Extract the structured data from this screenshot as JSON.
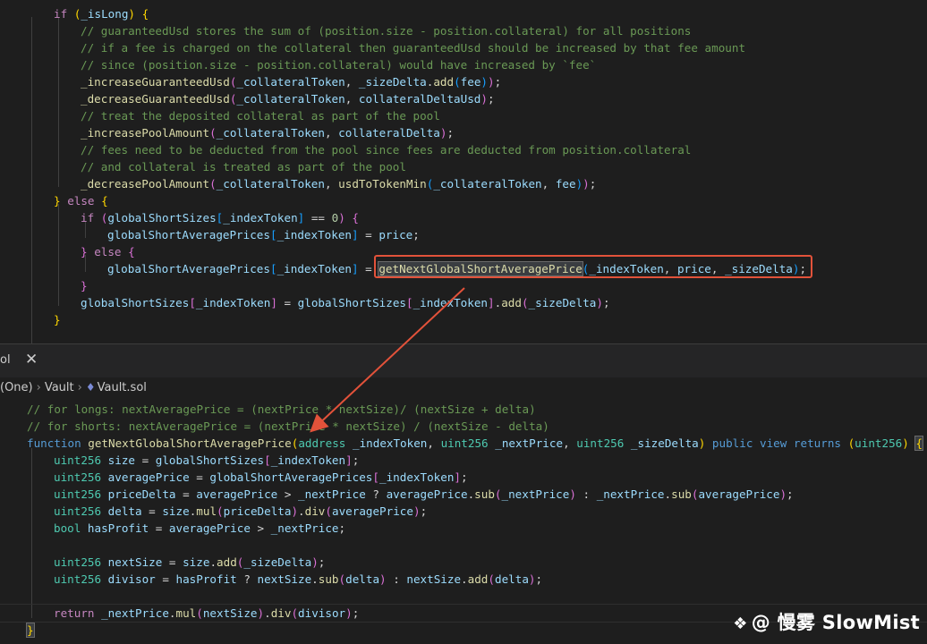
{
  "editor_top": {
    "lines": [
      [
        [
          "c-kw",
          "if "
        ],
        [
          "c-br1",
          "("
        ],
        [
          "c-var",
          "_isLong"
        ],
        [
          "c-br1",
          ")"
        ],
        [
          "c-plain",
          " "
        ],
        [
          "c-br1",
          "{"
        ]
      ],
      [
        [
          "c-com",
          "// guaranteedUsd stores the sum of (position.size - position.collateral) for all positions"
        ]
      ],
      [
        [
          "c-com",
          "// if a fee is charged on the collateral then guaranteedUsd should be increased by that fee amount"
        ]
      ],
      [
        [
          "c-com",
          "// since (position.size - position.collateral) would have increased by `fee`"
        ]
      ],
      [
        [
          "c-fn",
          "_increaseGuaranteedUsd"
        ],
        [
          "c-br2",
          "("
        ],
        [
          "c-var",
          "_collateralToken"
        ],
        [
          "c-plain",
          ", "
        ],
        [
          "c-var",
          "_sizeDelta"
        ],
        [
          "c-plain",
          "."
        ],
        [
          "c-fn",
          "add"
        ],
        [
          "c-br3",
          "("
        ],
        [
          "c-var",
          "fee"
        ],
        [
          "c-br3",
          ")"
        ],
        [
          "c-br2",
          ")"
        ],
        [
          "c-plain",
          ";"
        ]
      ],
      [
        [
          "c-fn",
          "_decreaseGuaranteedUsd"
        ],
        [
          "c-br2",
          "("
        ],
        [
          "c-var",
          "_collateralToken"
        ],
        [
          "c-plain",
          ", "
        ],
        [
          "c-var",
          "collateralDeltaUsd"
        ],
        [
          "c-br2",
          ")"
        ],
        [
          "c-plain",
          ";"
        ]
      ],
      [
        [
          "c-com",
          "// treat the deposited collateral as part of the pool"
        ]
      ],
      [
        [
          "c-fn",
          "_increasePoolAmount"
        ],
        [
          "c-br2",
          "("
        ],
        [
          "c-var",
          "_collateralToken"
        ],
        [
          "c-plain",
          ", "
        ],
        [
          "c-var",
          "collateralDelta"
        ],
        [
          "c-br2",
          ")"
        ],
        [
          "c-plain",
          ";"
        ]
      ],
      [
        [
          "c-com",
          "// fees need to be deducted from the pool since fees are deducted from position.collateral"
        ]
      ],
      [
        [
          "c-com",
          "// and collateral is treated as part of the pool"
        ]
      ],
      [
        [
          "c-fn",
          "_decreasePoolAmount"
        ],
        [
          "c-br2",
          "("
        ],
        [
          "c-var",
          "_collateralToken"
        ],
        [
          "c-plain",
          ", "
        ],
        [
          "c-fn",
          "usdToTokenMin"
        ],
        [
          "c-br3",
          "("
        ],
        [
          "c-var",
          "_collateralToken"
        ],
        [
          "c-plain",
          ", "
        ],
        [
          "c-var",
          "fee"
        ],
        [
          "c-br3",
          ")"
        ],
        [
          "c-br2",
          ")"
        ],
        [
          "c-plain",
          ";"
        ]
      ],
      [
        [
          "c-br1",
          "}"
        ],
        [
          "c-plain",
          " "
        ],
        [
          "c-kw",
          "else"
        ],
        [
          "c-plain",
          " "
        ],
        [
          "c-br1",
          "{"
        ]
      ],
      [
        [
          "c-kw",
          "if "
        ],
        [
          "c-br2",
          "("
        ],
        [
          "c-var",
          "globalShortSizes"
        ],
        [
          "c-br3",
          "["
        ],
        [
          "c-var",
          "_indexToken"
        ],
        [
          "c-br3",
          "]"
        ],
        [
          "c-plain",
          " == "
        ],
        [
          "c-num",
          "0"
        ],
        [
          "c-br2",
          ")"
        ],
        [
          "c-plain",
          " "
        ],
        [
          "c-br2",
          "{"
        ]
      ],
      [
        [
          "c-var",
          "globalShortAveragePrices"
        ],
        [
          "c-br3",
          "["
        ],
        [
          "c-var",
          "_indexToken"
        ],
        [
          "c-br3",
          "]"
        ],
        [
          "c-plain",
          " = "
        ],
        [
          "c-var",
          "price"
        ],
        [
          "c-plain",
          ";"
        ]
      ],
      [
        [
          "c-br2",
          "}"
        ],
        [
          "c-plain",
          " "
        ],
        [
          "c-kw",
          "else"
        ],
        [
          "c-plain",
          " "
        ],
        [
          "c-br2",
          "{"
        ]
      ],
      [
        [
          "c-var",
          "globalShortAveragePrices"
        ],
        [
          "c-br3",
          "["
        ],
        [
          "c-var",
          "_indexToken"
        ],
        [
          "c-br3",
          "]"
        ],
        [
          "c-plain",
          " = "
        ],
        [
          "c-fn hl-sel",
          "getNextGlobalShortAveragePrice"
        ],
        [
          "c-br3",
          "("
        ],
        [
          "c-var",
          "_indexToken"
        ],
        [
          "c-plain",
          ", "
        ],
        [
          "c-var",
          "price"
        ],
        [
          "c-plain",
          ", "
        ],
        [
          "c-var",
          "_sizeDelta"
        ],
        [
          "c-br3",
          ")"
        ],
        [
          "c-plain",
          ";"
        ]
      ],
      [
        [
          "c-br2",
          "}"
        ]
      ],
      [
        [
          "c-var",
          "globalShortSizes"
        ],
        [
          "c-br2",
          "["
        ],
        [
          "c-var",
          "_indexToken"
        ],
        [
          "c-br2",
          "]"
        ],
        [
          "c-plain",
          " = "
        ],
        [
          "c-var",
          "globalShortSizes"
        ],
        [
          "c-br2",
          "["
        ],
        [
          "c-var",
          "_indexToken"
        ],
        [
          "c-br2",
          "]"
        ],
        [
          "c-plain",
          "."
        ],
        [
          "c-fn",
          "add"
        ],
        [
          "c-br2",
          "("
        ],
        [
          "c-var",
          "_sizeDelta"
        ],
        [
          "c-br2",
          ")"
        ],
        [
          "c-plain",
          ";"
        ]
      ],
      [
        [
          "c-br1",
          "}"
        ]
      ]
    ]
  },
  "tabbar": {
    "tab_label": "ol",
    "close_glyph": "✕"
  },
  "breadcrumb": {
    "part1": "(One)",
    "sep": "›",
    "part2": "Vault",
    "file_icon": "♦",
    "part3": "Vault.sol"
  },
  "editor_bottom": {
    "lines": [
      [
        [
          "c-com",
          "// for longs: nextAveragePrice = (nextPrice * nextSize)/ (nextSize + delta)"
        ]
      ],
      [
        [
          "c-com",
          "// for shorts: nextAveragePrice = (nextPrice * nextSize) / (nextSize - delta)"
        ]
      ],
      [
        [
          "c-kw2",
          "function "
        ],
        [
          "c-fn",
          "getNextGlobalShortAveragePrice"
        ],
        [
          "c-br1",
          "("
        ],
        [
          "c-type",
          "address "
        ],
        [
          "c-var",
          "_indexToken"
        ],
        [
          "c-plain",
          ", "
        ],
        [
          "c-type",
          "uint256 "
        ],
        [
          "c-var",
          "_nextPrice"
        ],
        [
          "c-plain",
          ", "
        ],
        [
          "c-type",
          "uint256 "
        ],
        [
          "c-var",
          "_sizeDelta"
        ],
        [
          "c-br1",
          ")"
        ],
        [
          "c-plain",
          " "
        ],
        [
          "c-kw2",
          "public view returns "
        ],
        [
          "c-br1",
          "("
        ],
        [
          "c-type",
          "uint256"
        ],
        [
          "c-br1",
          ")"
        ],
        [
          "c-plain",
          " "
        ],
        [
          "c-br1 hl-sel",
          "{"
        ]
      ],
      [
        [
          "c-type",
          "uint256 "
        ],
        [
          "c-var",
          "size"
        ],
        [
          "c-plain",
          " = "
        ],
        [
          "c-var",
          "globalShortSizes"
        ],
        [
          "c-br2",
          "["
        ],
        [
          "c-var",
          "_indexToken"
        ],
        [
          "c-br2",
          "]"
        ],
        [
          "c-plain",
          ";"
        ]
      ],
      [
        [
          "c-type",
          "uint256 "
        ],
        [
          "c-var",
          "averagePrice"
        ],
        [
          "c-plain",
          " = "
        ],
        [
          "c-var",
          "globalShortAveragePrices"
        ],
        [
          "c-br2",
          "["
        ],
        [
          "c-var",
          "_indexToken"
        ],
        [
          "c-br2",
          "]"
        ],
        [
          "c-plain",
          ";"
        ]
      ],
      [
        [
          "c-type",
          "uint256 "
        ],
        [
          "c-var",
          "priceDelta"
        ],
        [
          "c-plain",
          " = "
        ],
        [
          "c-var",
          "averagePrice"
        ],
        [
          "c-plain",
          " > "
        ],
        [
          "c-var",
          "_nextPrice"
        ],
        [
          "c-plain",
          " ? "
        ],
        [
          "c-var",
          "averagePrice"
        ],
        [
          "c-plain",
          "."
        ],
        [
          "c-fn",
          "sub"
        ],
        [
          "c-br2",
          "("
        ],
        [
          "c-var",
          "_nextPrice"
        ],
        [
          "c-br2",
          ")"
        ],
        [
          "c-plain",
          " : "
        ],
        [
          "c-var",
          "_nextPrice"
        ],
        [
          "c-plain",
          "."
        ],
        [
          "c-fn",
          "sub"
        ],
        [
          "c-br2",
          "("
        ],
        [
          "c-var",
          "averagePrice"
        ],
        [
          "c-br2",
          ")"
        ],
        [
          "c-plain",
          ";"
        ]
      ],
      [
        [
          "c-type",
          "uint256 "
        ],
        [
          "c-var",
          "delta"
        ],
        [
          "c-plain",
          " = "
        ],
        [
          "c-var",
          "size"
        ],
        [
          "c-plain",
          "."
        ],
        [
          "c-fn",
          "mul"
        ],
        [
          "c-br2",
          "("
        ],
        [
          "c-var",
          "priceDelta"
        ],
        [
          "c-br2",
          ")"
        ],
        [
          "c-plain",
          "."
        ],
        [
          "c-fn",
          "div"
        ],
        [
          "c-br2",
          "("
        ],
        [
          "c-var",
          "averagePrice"
        ],
        [
          "c-br2",
          ")"
        ],
        [
          "c-plain",
          ";"
        ]
      ],
      [
        [
          "c-type",
          "bool "
        ],
        [
          "c-var",
          "hasProfit"
        ],
        [
          "c-plain",
          " = "
        ],
        [
          "c-var",
          "averagePrice"
        ],
        [
          "c-plain",
          " > "
        ],
        [
          "c-var",
          "_nextPrice"
        ],
        [
          "c-plain",
          ";"
        ]
      ],
      [],
      [
        [
          "c-type",
          "uint256 "
        ],
        [
          "c-var",
          "nextSize"
        ],
        [
          "c-plain",
          " = "
        ],
        [
          "c-var",
          "size"
        ],
        [
          "c-plain",
          "."
        ],
        [
          "c-fn",
          "add"
        ],
        [
          "c-br2",
          "("
        ],
        [
          "c-var",
          "_sizeDelta"
        ],
        [
          "c-br2",
          ")"
        ],
        [
          "c-plain",
          ";"
        ]
      ],
      [
        [
          "c-type",
          "uint256 "
        ],
        [
          "c-var",
          "divisor"
        ],
        [
          "c-plain",
          " = "
        ],
        [
          "c-var",
          "hasProfit"
        ],
        [
          "c-plain",
          " ? "
        ],
        [
          "c-var",
          "nextSize"
        ],
        [
          "c-plain",
          "."
        ],
        [
          "c-fn",
          "sub"
        ],
        [
          "c-br2",
          "("
        ],
        [
          "c-var",
          "delta"
        ],
        [
          "c-br2",
          ")"
        ],
        [
          "c-plain",
          " : "
        ],
        [
          "c-var",
          "nextSize"
        ],
        [
          "c-plain",
          "."
        ],
        [
          "c-fn",
          "add"
        ],
        [
          "c-br2",
          "("
        ],
        [
          "c-var",
          "delta"
        ],
        [
          "c-br2",
          ")"
        ],
        [
          "c-plain",
          ";"
        ]
      ],
      [],
      [
        [
          "c-kw",
          "return "
        ],
        [
          "c-var",
          "_nextPrice"
        ],
        [
          "c-plain",
          "."
        ],
        [
          "c-fn",
          "mul"
        ],
        [
          "c-br2",
          "("
        ],
        [
          "c-var",
          "nextSize"
        ],
        [
          "c-br2",
          ")"
        ],
        [
          "c-plain",
          "."
        ],
        [
          "c-fn",
          "div"
        ],
        [
          "c-br2",
          "("
        ],
        [
          "c-var",
          "divisor"
        ],
        [
          "c-br2",
          ")"
        ],
        [
          "c-plain",
          ";"
        ]
      ],
      [
        [
          "c-br1 hl-sel",
          "}"
        ]
      ]
    ]
  },
  "watermark": {
    "logo_glyph": "❖",
    "text": "@ 慢雾 SlowMist"
  },
  "colors": {
    "highlight_box": "#e2523a",
    "arrow": "#e2523a",
    "background": "#1e1e1e"
  },
  "icons": {
    "close": "close-icon",
    "file": "solidity-file-icon",
    "watermark": "slowmist-logo-icon"
  }
}
